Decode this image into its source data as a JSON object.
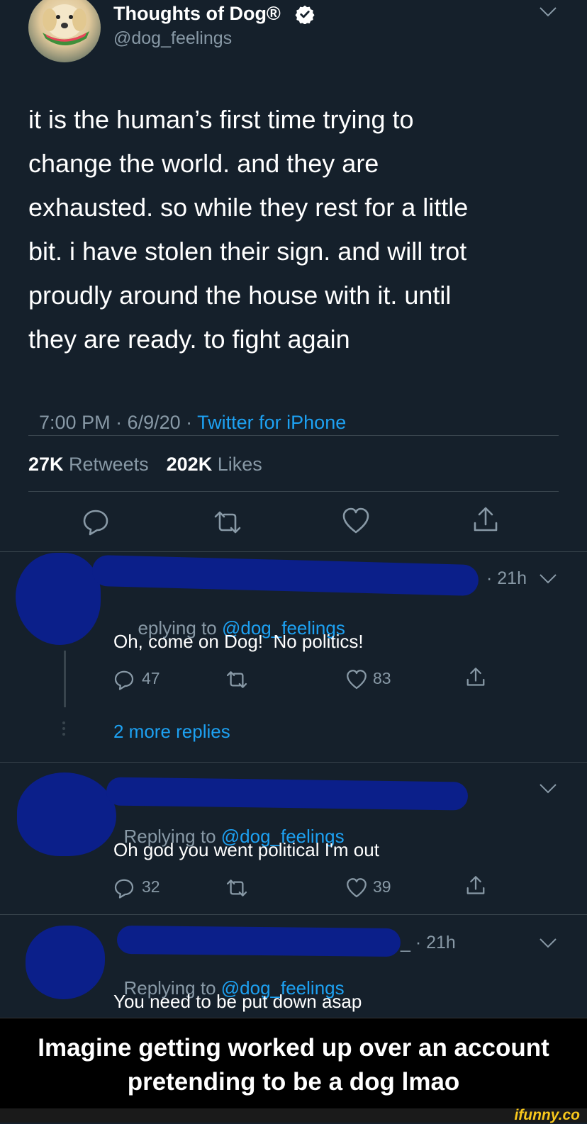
{
  "tweet": {
    "display_name": "Thoughts of Dog®",
    "handle": "@dog_feelings",
    "text_lines": [
      "it is the human’s first time trying to",
      "change the world. and they are",
      "exhausted. so while they rest for a little",
      "bit. i have stolen their sign. and will trot",
      "proudly around the house with it. until",
      "they are ready. to fight again"
    ],
    "time": "7:00 PM · 6/9/20 · ",
    "source": "Twitter for iPhone",
    "retweets_count": "27K",
    "retweets_label": "Retweets",
    "likes_count": "202K",
    "likes_label": "Likes",
    "icons": {
      "reply": "reply-icon",
      "retweet": "retweet-icon",
      "like": "heart-icon",
      "share": "share-icon",
      "chevron": "chevron-down-icon",
      "verified": "verified-badge-icon"
    }
  },
  "replies": [
    {
      "time": "· 21h",
      "replying_prefix": "eplying to ",
      "replying_handle": "@dog_feelings",
      "text": "Oh, come on Dog!  No politics!",
      "reply_count": "47",
      "like_count": "83",
      "more_replies": "2 more replies"
    },
    {
      "replying_prefix": "Replying to ",
      "replying_handle": "@dog_feelings",
      "text": "Oh god you went political I'm out",
      "reply_count": "32",
      "like_count": "39"
    },
    {
      "time": "_ · 21h",
      "replying_prefix": "Replying to ",
      "replying_handle": "@dog_feelings",
      "text": "You need to be put down asap"
    }
  ],
  "caption": {
    "line1": "Imagine getting worked up over an account",
    "line2": "pretending to be a dog lmao"
  },
  "watermark": "ifunny.co",
  "colors": {
    "background": "#15202b",
    "accent": "#1da1f2",
    "muted": "#8899a6",
    "redaction": "#0b1f8a",
    "caption_bg": "#000000",
    "watermark": "#f8c81c"
  }
}
